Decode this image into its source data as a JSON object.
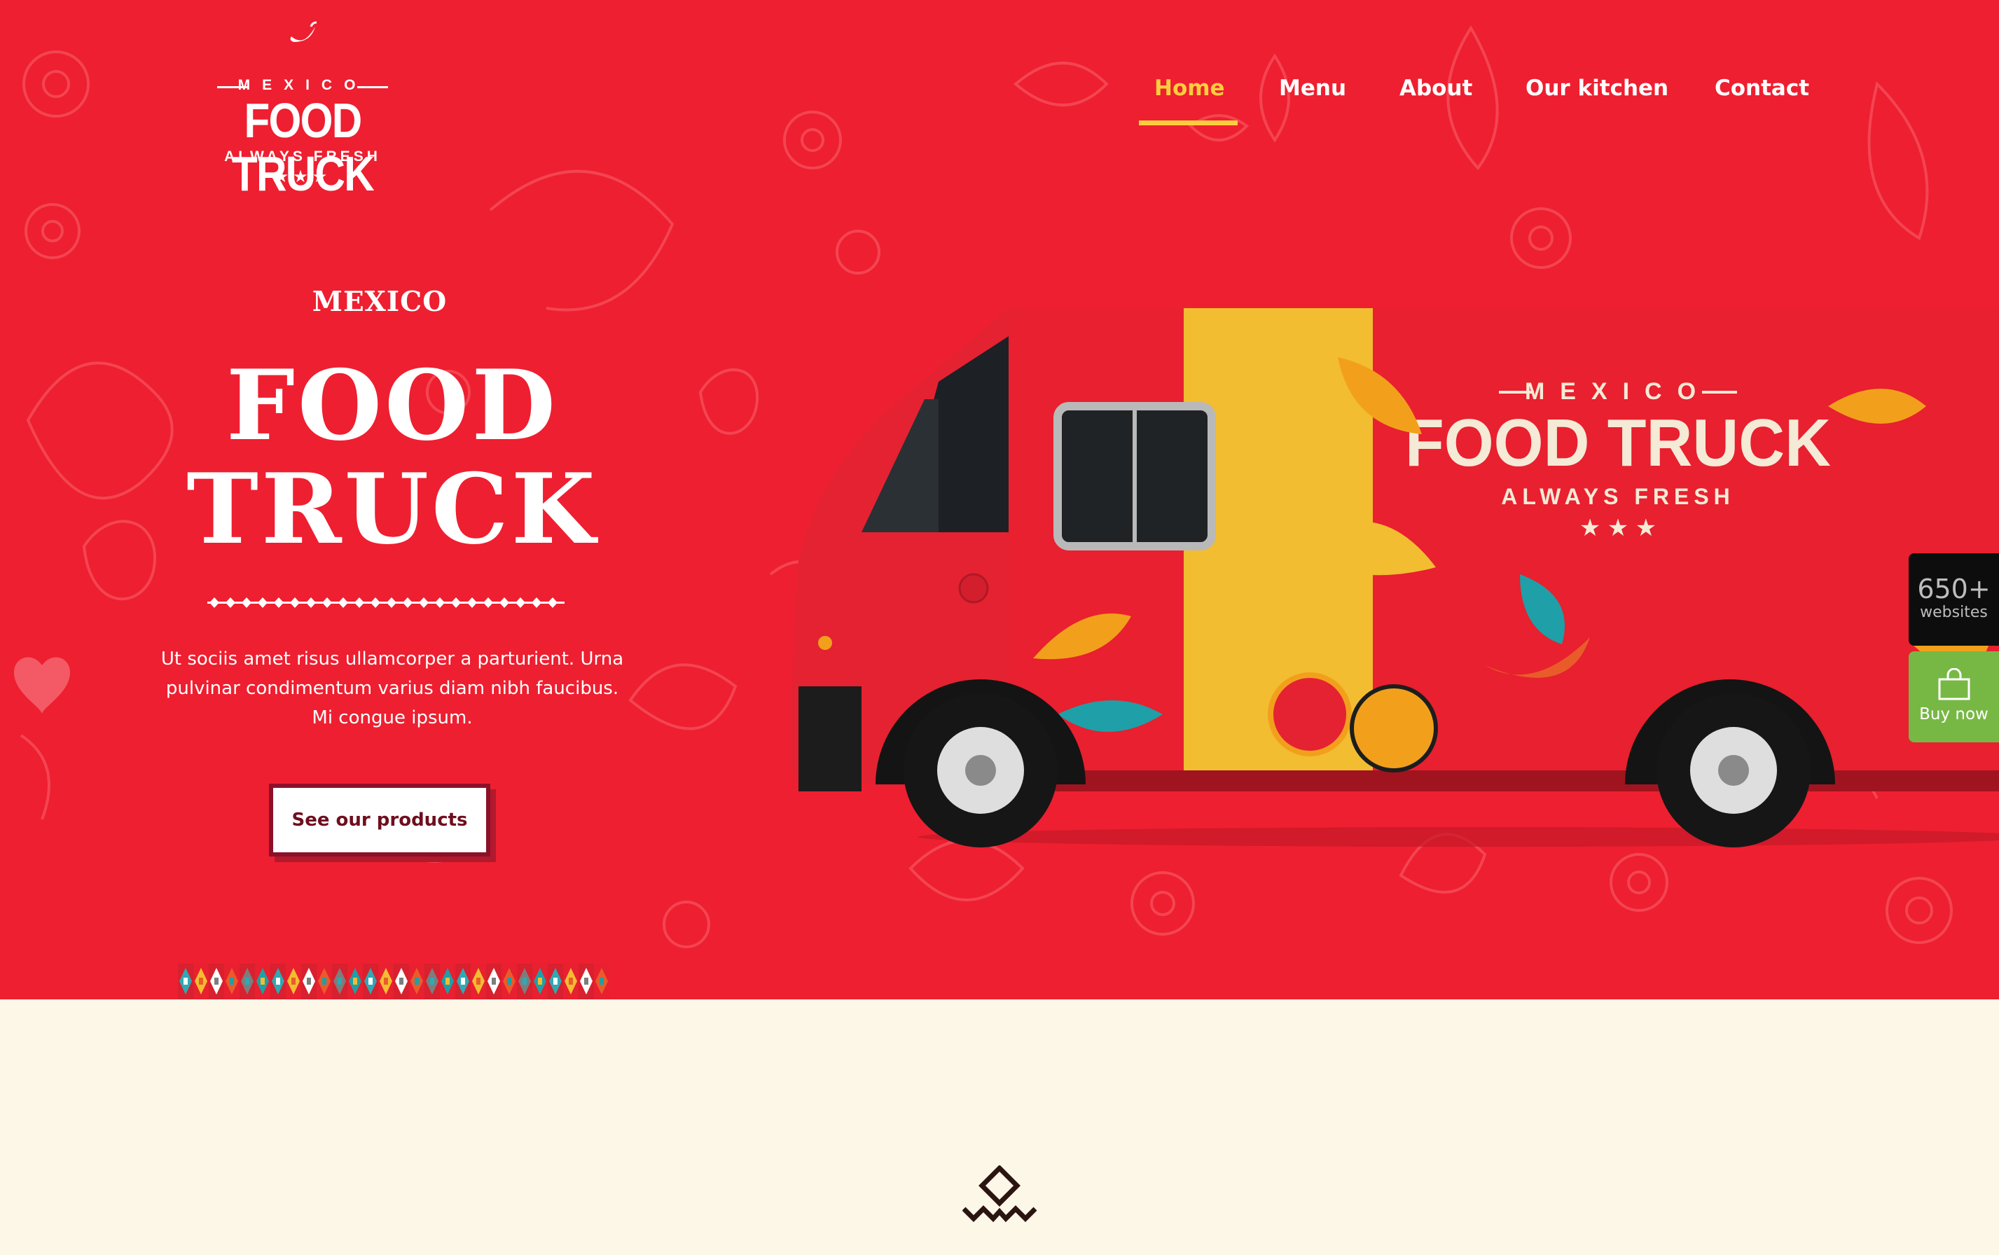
{
  "brand": {
    "logo_top": "MEXICO",
    "logo_main": "FOOD TRUCK",
    "logo_sub": "ALWAYS FRESH",
    "logo_stars": "★★★"
  },
  "nav": {
    "items": [
      {
        "label": "Home",
        "active": true
      },
      {
        "label": "Menu",
        "active": false
      },
      {
        "label": "About",
        "active": false
      },
      {
        "label": "Our kitchen",
        "active": false
      },
      {
        "label": "Contact",
        "active": false
      }
    ]
  },
  "hero": {
    "eyebrow": "MEXICO",
    "title_line1": "FOOD",
    "title_line2": "TRUCK",
    "description": "Ut sociis amet risus ullamcorper a parturient. Urna pulvinar condimentum varius diam nibh faucibus. Mi congue ipsum.",
    "cta_label": "See our products"
  },
  "truck_graphic": {
    "logo_top": "MEXICO",
    "logo_main": "FOOD TRUCK",
    "logo_sub": "ALWAYS FRESH"
  },
  "widgets": {
    "sites_count": "650+",
    "sites_label": "websites",
    "buy_label": "Buy now"
  },
  "colors": {
    "hero_bg": "#ee1f30",
    "accent_yellow": "#fccd3d",
    "cream_bg": "#fdf7e8",
    "button_border": "#8c1029",
    "buy_green": "#77b845"
  }
}
